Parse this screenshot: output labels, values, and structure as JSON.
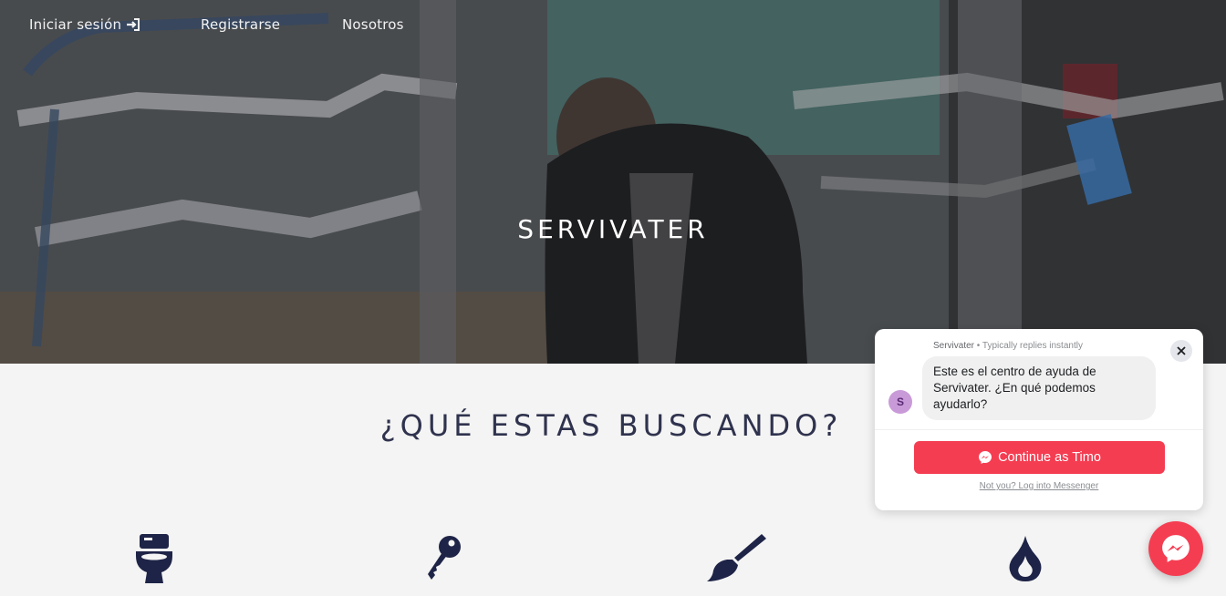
{
  "nav": {
    "login_label": "Iniciar sesión",
    "login_icon": "sign-in-icon",
    "register_label": "Registrarse",
    "about_label": "Nosotros"
  },
  "hero": {
    "brand": "SERVIVATER"
  },
  "main": {
    "section_title": "¿QUÉ ESTAS BUSCANDO?",
    "services": [
      {
        "icon": "toilet-icon"
      },
      {
        "icon": "key-icon"
      },
      {
        "icon": "paint-brush-icon"
      },
      {
        "icon": "fire-icon"
      }
    ],
    "icon_color": "#1e2447"
  },
  "chat": {
    "page_name": "Servivater",
    "separator": " • ",
    "reply_status": "Typically replies instantly",
    "avatar_letter": "S",
    "message": "Este es el centro de ayuda de Servivater. ¿En qué podemos ayudarlo?",
    "cta_label": "Continue as Timo",
    "alt_link": "Not you? Log into Messenger",
    "accent_color": "#f53d52"
  }
}
